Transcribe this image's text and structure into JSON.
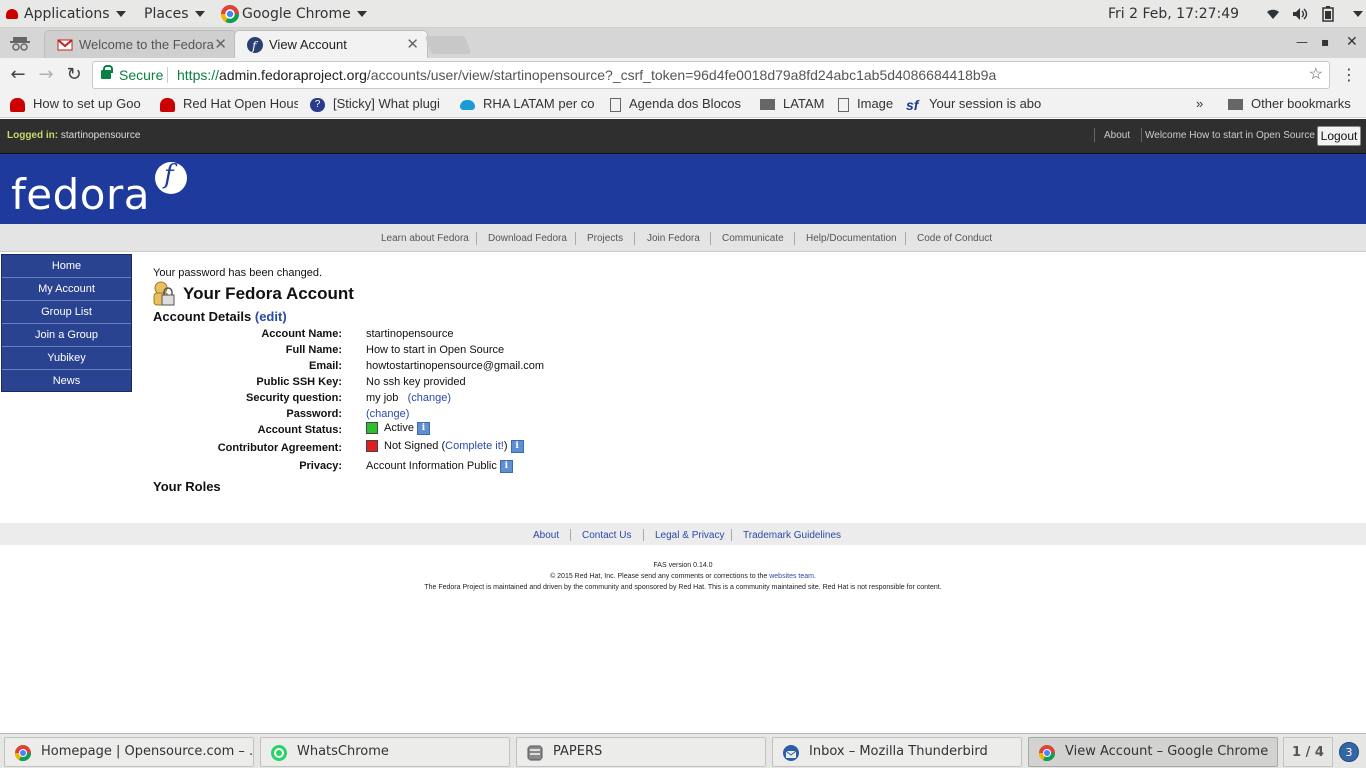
{
  "topbar": {
    "applications": "Applications",
    "places": "Places",
    "active_app": "Google Chrome",
    "clock": "Fri  2 Feb, 17:27:49"
  },
  "tabs": [
    {
      "title": "Welcome to the Fedora",
      "active": false
    },
    {
      "title": "View Account",
      "active": true
    }
  ],
  "omnibox": {
    "secure_label": "Secure",
    "url_proto": "https://",
    "url_host": "admin.fedoraproject.org",
    "url_path": "/accounts/user/view/startinopensource?_csrf_token=96d4fe0018d79a8fd24abc1ab5d4086684418b9a"
  },
  "bookmarks": {
    "items": [
      {
        "label": "How to set up Goo"
      },
      {
        "label": "Red Hat Open Hous"
      },
      {
        "label": "[Sticky] What plugi"
      },
      {
        "label": "RHA LATAM per co"
      },
      {
        "label": "Agenda dos Blocos"
      },
      {
        "label": "LATAM"
      },
      {
        "label": "Image"
      },
      {
        "label": "Your session is abo"
      }
    ],
    "overflow": "»",
    "other": "Other bookmarks"
  },
  "fas": {
    "logged_in_label": "Logged in:",
    "logged_in_user": "startinopensource",
    "about": "About",
    "welcome": "Welcome How to start in Open Source",
    "logout": "Logout"
  },
  "banner": {
    "logo": "fedora",
    "logo_mark": "f"
  },
  "topnav": [
    "Learn about Fedora",
    "Download Fedora",
    "Projects",
    "Join Fedora",
    "Communicate",
    "Help/Documentation",
    "Code of Conduct"
  ],
  "sidenav": [
    "Home",
    "My Account",
    "Group List",
    "Join a Group",
    "Yubikey",
    "News"
  ],
  "content": {
    "message": "Your password has been changed.",
    "title": "Your Fedora Account",
    "details_heading": "Account Details",
    "edit_link": "(edit)",
    "rows": {
      "account_name": {
        "label": "Account Name:",
        "value": "startinopensource"
      },
      "full_name": {
        "label": "Full Name:",
        "value": "How to start in Open Source"
      },
      "email": {
        "label": "Email:",
        "value": "howtostartinopensource@gmail.com"
      },
      "ssh": {
        "label": "Public SSH Key:",
        "value": "No ssh key provided"
      },
      "security": {
        "label": "Security question:",
        "value": "my job",
        "link": "(change)"
      },
      "password": {
        "label": "Password:",
        "link": "(change)"
      },
      "status": {
        "label": "Account Status:",
        "value": "Active"
      },
      "cla": {
        "label": "Contributor Agreement:",
        "value": "Not Signed (",
        "link": "Complete it!",
        "close": ")"
      },
      "privacy": {
        "label": "Privacy:",
        "value": "Account Information Public"
      }
    },
    "roles_heading": "Your Roles"
  },
  "footnav": [
    "About",
    "Contact Us",
    "Legal & Privacy",
    "Trademark Guidelines"
  ],
  "footer": {
    "version": "FAS version 0.14.0",
    "copyright_pre": "© 2015 Red Hat, Inc. Please send any comments or corrections to the",
    "copyright_link": "websites team",
    "copyright_post": ".",
    "disclaimer": "The Fedora Project is maintained and driven by the community and sponsored by Red Hat. This is a community maintained site. Red Hat is not responsible for content."
  },
  "taskbar": {
    "tasks": [
      {
        "label": "Homepage | Opensource.com – ..."
      },
      {
        "label": "WhatsChrome"
      },
      {
        "label": "PAPERS"
      },
      {
        "label": "Inbox – Mozilla Thunderbird"
      },
      {
        "label": "View Account – Google Chrome"
      }
    ],
    "workspace": "1 / 4",
    "notifications": "3"
  },
  "colors": {
    "fedora_blue": "#1d3a9c",
    "sidenav": "#2a4391",
    "link": "#2b4aa8",
    "secure_green": "#0b8043"
  }
}
